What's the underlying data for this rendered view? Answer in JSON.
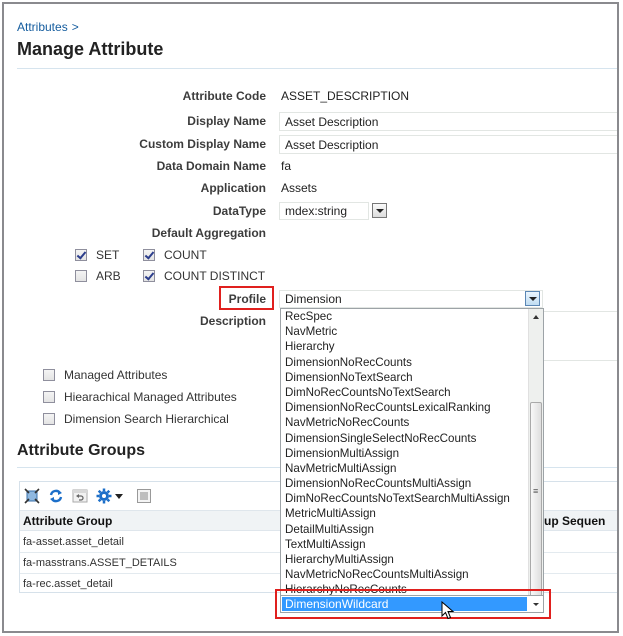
{
  "breadcrumb": {
    "link": "Attributes",
    "separator": ">"
  },
  "page_title": "Manage Attribute",
  "form": {
    "attribute_code": {
      "label": "Attribute Code",
      "value": "ASSET_DESCRIPTION"
    },
    "display_name": {
      "label": "Display Name",
      "value": "Asset Description"
    },
    "custom_display_name": {
      "label": "Custom Display Name",
      "value": "Asset Description"
    },
    "data_domain_name": {
      "label": "Data Domain Name",
      "value": "fa"
    },
    "application": {
      "label": "Application",
      "value": "Assets"
    },
    "datatype": {
      "label": "DataType",
      "value": "mdex:string"
    },
    "default_aggregation": {
      "label": "Default Aggregation",
      "options": [
        {
          "label": "SET",
          "checked": true
        },
        {
          "label": "COUNT",
          "checked": true
        },
        {
          "label": "ARB",
          "checked": false
        },
        {
          "label": "COUNT DISTINCT",
          "checked": true
        }
      ]
    },
    "profile": {
      "label": "Profile",
      "value": "Dimension"
    },
    "description": {
      "label": "Description",
      "value": ""
    },
    "flags": [
      {
        "label": "Managed Attributes",
        "checked": false
      },
      {
        "label": "Hiearachical Managed Attributes",
        "checked": false
      },
      {
        "label": "Dimension Search Hierarchical",
        "checked": false
      }
    ]
  },
  "profile_dropdown": {
    "options": [
      "RecSpec",
      "NavMetric",
      "Hierarchy",
      "DimensionNoRecCounts",
      "DimensionNoTextSearch",
      "DimNoRecCountsNoTextSearch",
      "DimensionNoRecCountsLexicalRanking",
      "NavMetricNoRecCounts",
      "DimensionSingleSelectNoRecCounts",
      "DimensionMultiAssign",
      "NavMetricMultiAssign",
      "DimensionNoRecCountsMultiAssign",
      "DimNoRecCountsNoTextSearchMultiAssign",
      "MetricMultiAssign",
      "DetailMultiAssign",
      "TextMultiAssign",
      "HierarchyMultiAssign",
      "NavMetricNoRecCountsMultiAssign",
      "HierarchyNoRecCounts"
    ],
    "highlighted": "DimensionWildcard"
  },
  "attribute_groups": {
    "title": "Attribute Groups",
    "columns": [
      "Attribute Group",
      "Group Sequence"
    ],
    "visible_column_fragment": "roup Sequen",
    "rows": [
      "fa-asset.asset_detail",
      "fa-masstrans.ASSET_DETAILS",
      "fa-rec.asset_detail"
    ],
    "toolbar": [
      "detach-icon",
      "refresh-icon",
      "undo-icon",
      "settings-icon",
      "columns-icon"
    ]
  },
  "colors": {
    "link": "#145c9e",
    "highlight": "#3399ff",
    "callout_red": "#e0201e"
  }
}
